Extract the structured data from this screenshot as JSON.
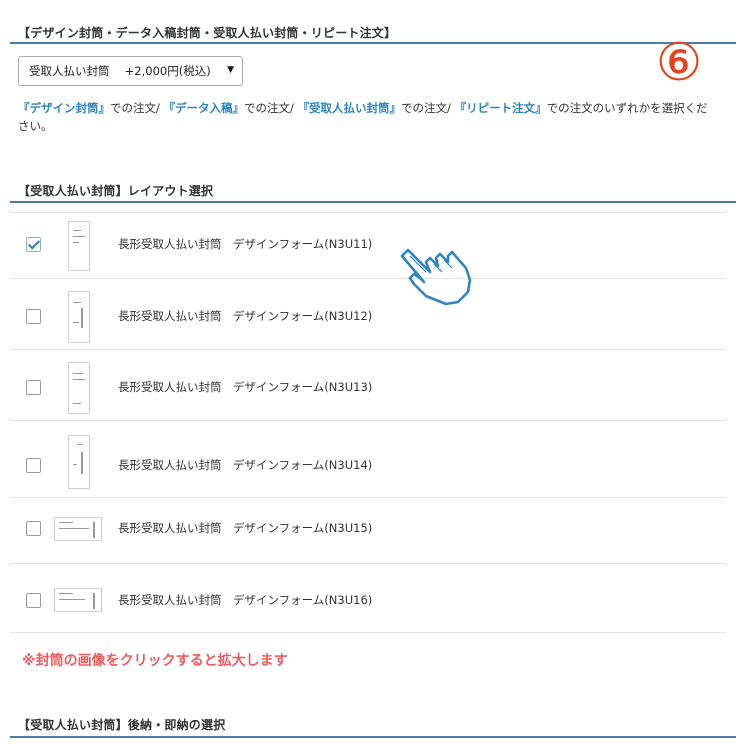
{
  "sections": {
    "envelope_type": {
      "title": "【デザイン封筒・データ入稿封筒・受取人払い封筒・リピート注文】"
    },
    "layout": {
      "title": "【受取人払い封筒】レイアウト選択"
    },
    "payment": {
      "title": "【受取人払い封筒】後納・即納の選択"
    }
  },
  "select": {
    "value": "受取人払い封筒　 +2,000円(税込)"
  },
  "step_number": "⑥",
  "description": {
    "q1": "『デザイン封筒』",
    "t1": "での注文/",
    "q2": "『データ入稿』",
    "t2": "での注文/",
    "q3": "『受取人払い封筒』",
    "t3": "での注文/",
    "q4": "『リピート注文』",
    "t4": "での注文のいずれかを選択ください。"
  },
  "layouts": [
    {
      "label": "長形受取人払い封筒　デザインフォーム(N3U11)",
      "checked": true
    },
    {
      "label": "長形受取人払い封筒　デザインフォーム(N3U12)",
      "checked": false
    },
    {
      "label": "長形受取人払い封筒　デザインフォーム(N3U13)",
      "checked": false
    },
    {
      "label": "長形受取人払い封筒　デザインフォーム(N3U14)",
      "checked": false
    },
    {
      "label": "長形受取人払い封筒　デザインフォーム(N3U15)",
      "checked": false
    },
    {
      "label": "長形受取人払い封筒　デザインフォーム(N3U16)",
      "checked": false
    }
  ],
  "notice": "※封筒の画像をクリックすると拡大します",
  "colors": {
    "accent": "#2e86c1",
    "rule": "#4a7aa6",
    "warning": "#ef5b5b",
    "step": "#e8411a"
  },
  "icons": {
    "pointer": "hand-pointer-icon",
    "caret": "dropdown-caret-icon"
  }
}
